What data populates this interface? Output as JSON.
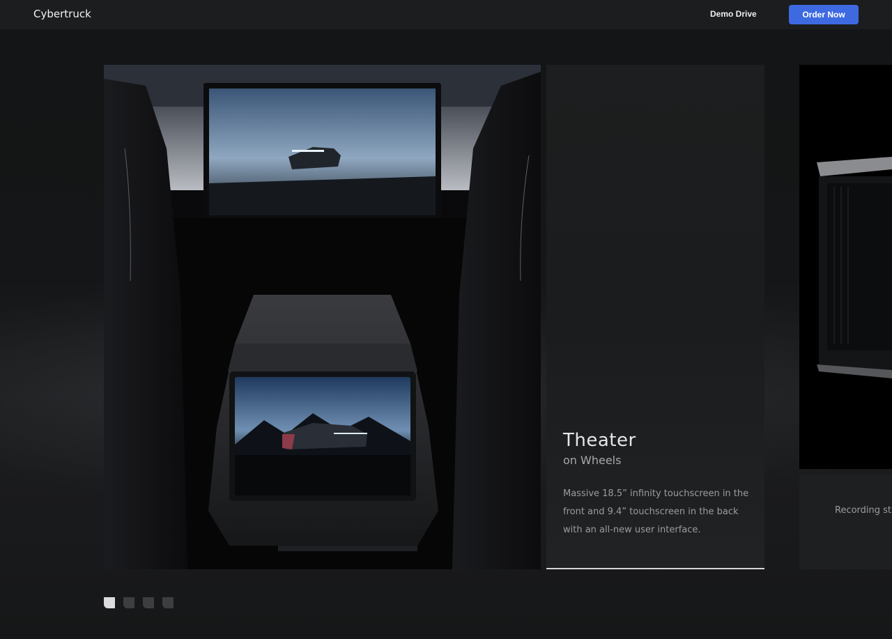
{
  "header": {
    "brand": "Cybertruck",
    "demo_drive_label": "Demo Drive",
    "order_now_label": "Order Now",
    "accent_color": "#3e6ae1"
  },
  "carousel": {
    "active_index": 0,
    "slides": [
      {
        "title": "Theater",
        "subtitle": "on Wheels",
        "description": "Massive 18.5” infinity touchscreen in the front and 9.4” touchscreen in the back with an all-new user interface.",
        "progress": 1.0
      },
      {
        "description_partial": "Recording st"
      }
    ],
    "pagination_count": 4
  }
}
